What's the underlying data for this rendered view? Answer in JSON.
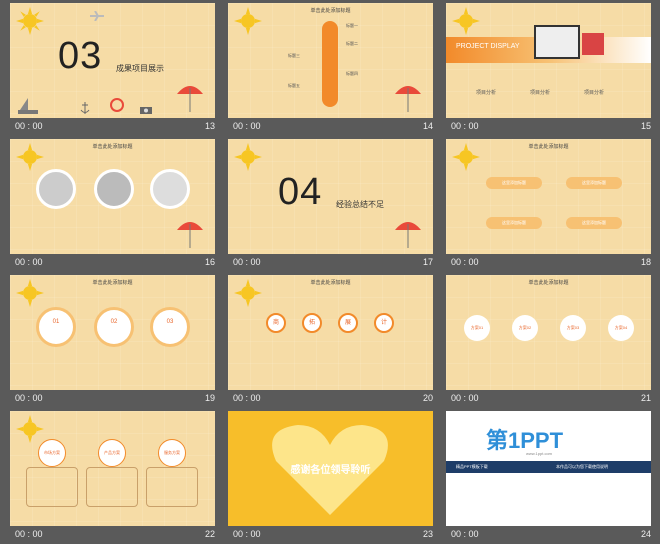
{
  "slides": [
    {
      "num": "13",
      "time": "  00 : 00",
      "big": "03",
      "subtitle": "成果项目展示"
    },
    {
      "num": "14",
      "time": "  00 : 00",
      "title": "单击此处添加标题",
      "labels": [
        "标题一",
        "标题二",
        "标题三",
        "标题四",
        "标题五"
      ]
    },
    {
      "num": "15",
      "time": "  00 : 00",
      "banner": "PROJECT DISPLAY",
      "items": [
        "项目分析",
        "项目分析",
        "项目分析"
      ]
    },
    {
      "num": "16",
      "time": "  00 : 00",
      "title": "单击此处添加标题"
    },
    {
      "num": "17",
      "time": "  00 : 00",
      "big": "04",
      "subtitle": "经验总结不足"
    },
    {
      "num": "18",
      "time": "  00 : 00",
      "title": "单击此处添加标题",
      "box_labels": [
        "这里添加标题",
        "这里添加标题",
        "这里添加标题",
        "这里添加标题"
      ]
    },
    {
      "num": "19",
      "time": "  00 : 00",
      "title": "单击此处添加标题",
      "circles": [
        "01",
        "02",
        "03"
      ],
      "circle_caption": "这里添加标题"
    },
    {
      "num": "20",
      "time": "  00 : 00",
      "title": "单击此处添加标题",
      "chars": [
        "商",
        "拓",
        "展",
        "计"
      ],
      "caption": "这里添加标题"
    },
    {
      "num": "21",
      "time": "  00 : 00",
      "title": "单击此处添加标题",
      "plans": [
        "方案01",
        "方案02",
        "方案03",
        "方案04"
      ]
    },
    {
      "num": "22",
      "time": "  00 : 00",
      "tags": [
        "市场方案",
        "产品方案",
        "服务方案"
      ]
    },
    {
      "num": "23",
      "time": "  00 : 00",
      "thanks": "感谢各位领导聆听"
    },
    {
      "num": "24",
      "time": "  00 : 00",
      "logo_text": "第1PPT",
      "logo_sub": "www.1ppt.com",
      "left_head": "精品PPT模板下载",
      "right_head": "本作品可以为您下载使用说明"
    }
  ],
  "colors": {
    "accent": "#f28a2a",
    "sun": "#f7c623",
    "bg": "#f6dca6",
    "gray": "#5a5a5a"
  }
}
